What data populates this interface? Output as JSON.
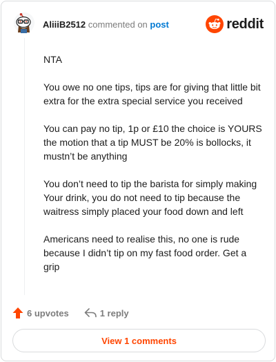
{
  "header": {
    "username": "AliiiB2512",
    "verb": "commented on",
    "post_link": "post",
    "brand": "reddit"
  },
  "comment": {
    "paragraphs": [
      "NTA",
      "You owe no one tips, tips are for giving that little bit extra for the extra special service you received",
      "You can pay no tip, 1p or £10 the choice is YOURS the motion that a tip MUST be 20% is bollocks, it mustn’t be anything",
      "You don’t need to tip the barista for simply making Your drink, you do not need to tip because the waitress simply placed your food down and left",
      "Americans need to realise this, no one is rude because I didn’t tip on my fast food order. Get a grip"
    ]
  },
  "actions": {
    "upvotes": "6 upvotes",
    "replies": "1 reply"
  },
  "view_button": "View 1 comments",
  "colors": {
    "brand_orange": "#ff4500",
    "link_blue": "#0079d3",
    "muted": "#7c7c7c"
  }
}
